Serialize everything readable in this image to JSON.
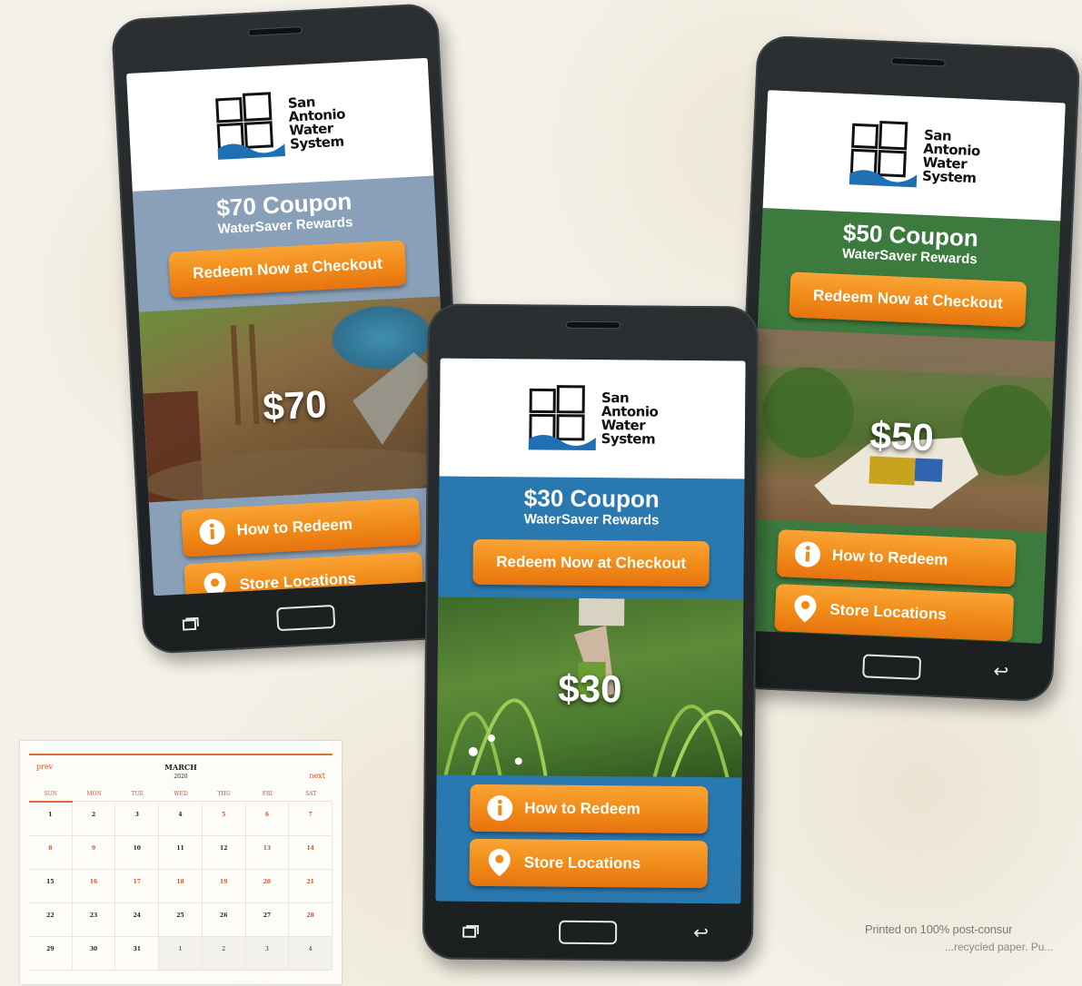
{
  "logo": {
    "lines": [
      "San",
      "Antonio",
      "Water",
      "System"
    ]
  },
  "phones": {
    "p70": {
      "title": "$70 Coupon",
      "subtitle": "WaterSaver Rewards",
      "redeem": "Redeem Now at Checkout",
      "amount": "$70",
      "how_to": "How to Redeem",
      "store": "Store Locations",
      "panel_color": "#8aa0b8"
    },
    "p30": {
      "title": "$30 Coupon",
      "subtitle": "WaterSaver Rewards",
      "redeem": "Redeem Now at Checkout",
      "amount": "$30",
      "how_to": "How to Redeem",
      "store": "Store Locations",
      "panel_color": "#2a78b0"
    },
    "p50": {
      "title": "$50 Coupon",
      "subtitle": "WaterSaver Rewards",
      "redeem": "Redeem Now at Checkout",
      "amount": "$50",
      "how_to": "How to Redeem",
      "store": "Store Locations",
      "panel_color": "#3c7a3e"
    }
  },
  "calendar": {
    "prev": "prev",
    "next": "next",
    "month": "MARCH",
    "year": "2020",
    "days": [
      "SUN",
      "MON",
      "TUE",
      "WED",
      "THU",
      "FRI",
      "SAT"
    ],
    "weeks": [
      [
        "1",
        "2",
        "3",
        "4",
        "5",
        "6",
        "7"
      ],
      [
        "8",
        "9",
        "10",
        "11",
        "12",
        "13",
        "14"
      ],
      [
        "15",
        "16",
        "17",
        "18",
        "19",
        "20",
        "21"
      ],
      [
        "22",
        "23",
        "24",
        "25",
        "26",
        "27",
        "28"
      ],
      [
        "29",
        "30",
        "31",
        "1",
        "2",
        "3",
        "4"
      ]
    ],
    "accent_color": "#d2552a"
  },
  "footer": {
    "printed": "Printed on 100% post-consur",
    "printed_line2": "...recycled paper. Pu..."
  },
  "icons": [
    "info-icon",
    "location-pin-icon",
    "recent-apps-icon",
    "home-button",
    "back-icon"
  ]
}
